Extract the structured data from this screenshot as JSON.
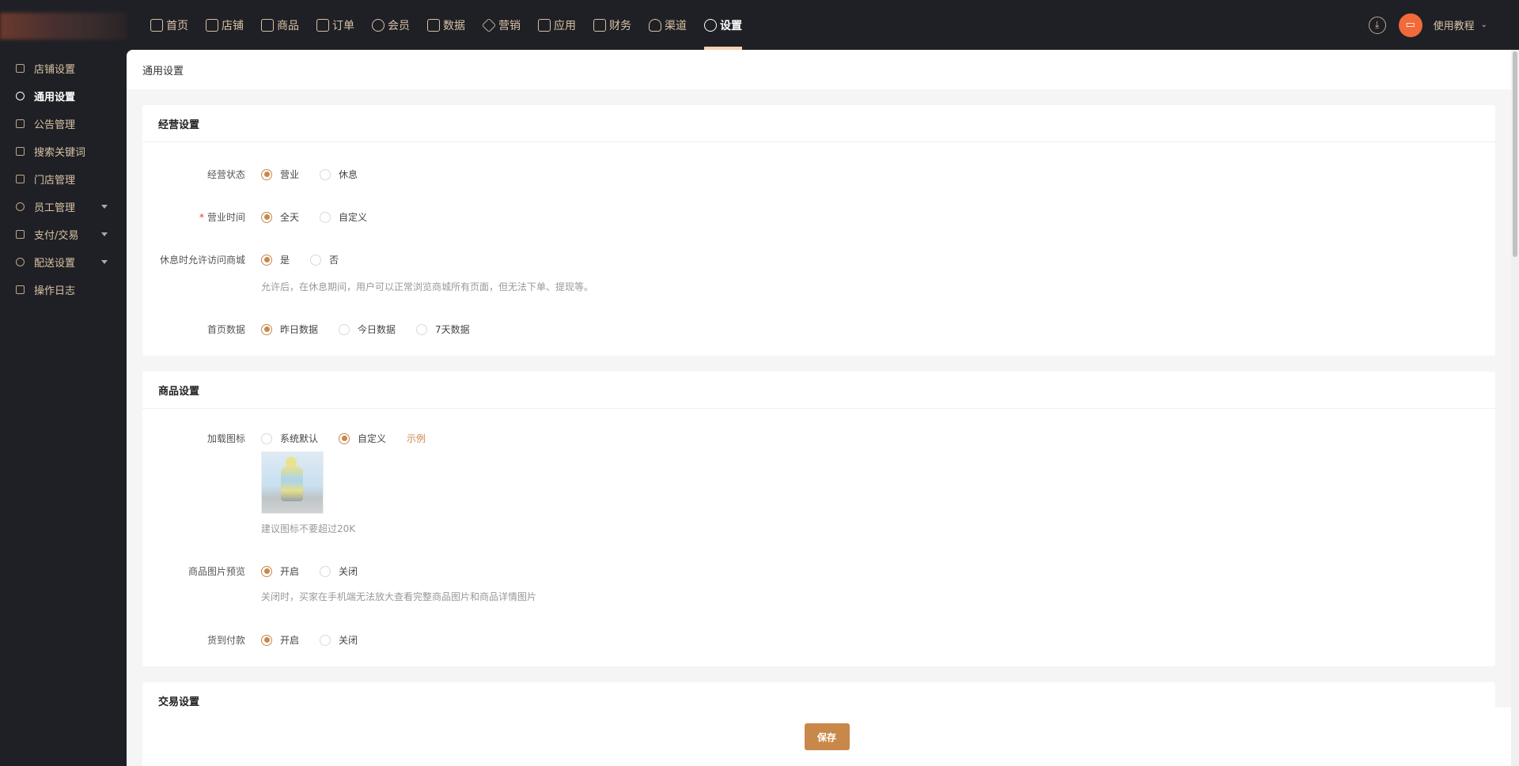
{
  "topnav": {
    "items": [
      {
        "label": "首页",
        "icon": "home-icon"
      },
      {
        "label": "店铺",
        "icon": "store-icon"
      },
      {
        "label": "商品",
        "icon": "goods-icon"
      },
      {
        "label": "订单",
        "icon": "order-icon"
      },
      {
        "label": "会员",
        "icon": "user-icon"
      },
      {
        "label": "数据",
        "icon": "chart-icon"
      },
      {
        "label": "营销",
        "icon": "tag-icon"
      },
      {
        "label": "应用",
        "icon": "app-icon"
      },
      {
        "label": "财务",
        "icon": "finance-icon"
      },
      {
        "label": "渠道",
        "icon": "channel-icon"
      },
      {
        "label": "设置",
        "icon": "gear-icon",
        "active": true
      }
    ],
    "tutorial": "使用教程"
  },
  "sidebar": {
    "items": [
      {
        "label": "店铺设置"
      },
      {
        "label": "通用设置",
        "active": true
      },
      {
        "label": "公告管理"
      },
      {
        "label": "搜索关键词"
      },
      {
        "label": "门店管理"
      },
      {
        "label": "员工管理",
        "expandable": true
      },
      {
        "label": "支付/交易",
        "expandable": true
      },
      {
        "label": "配送设置",
        "expandable": true
      },
      {
        "label": "操作日志"
      }
    ]
  },
  "page": {
    "title": "通用设置"
  },
  "business": {
    "title": "经营设置",
    "status": {
      "label": "经营状态",
      "options": [
        "营业",
        "休息"
      ],
      "selected": "营业"
    },
    "hours": {
      "label": "营业时间",
      "required": "*",
      "options": [
        "全天",
        "自定义"
      ],
      "selected": "全天"
    },
    "allow_visit": {
      "label": "休息时允许访问商城",
      "options": [
        "是",
        "否"
      ],
      "selected": "是",
      "hint": "允许后，在休息期间，用户可以正常浏览商城所有页面，但无法下单、提现等。"
    },
    "home_data": {
      "label": "首页数据",
      "options": [
        "昨日数据",
        "今日数据",
        "7天数据"
      ],
      "selected": "昨日数据"
    }
  },
  "goods": {
    "title": "商品设置",
    "loading_icon": {
      "label": "加载图标",
      "options": [
        "系统默认",
        "自定义"
      ],
      "selected": "自定义",
      "example": "示例",
      "hint": "建议图标不要超过20K"
    },
    "image_preview": {
      "label": "商品图片预览",
      "options": [
        "开启",
        "关闭"
      ],
      "selected": "开启",
      "hint": "关闭时，买家在手机端无法放大查看完整商品图片和商品详情图片"
    },
    "cod": {
      "label": "货到付款",
      "options": [
        "开启",
        "关闭"
      ],
      "selected": "开启"
    }
  },
  "trade": {
    "title": "交易设置"
  },
  "save_label": "保存",
  "colors": {
    "accent": "#c8884a",
    "topbar": "#1f2025",
    "avatar": "#f26a3a"
  }
}
